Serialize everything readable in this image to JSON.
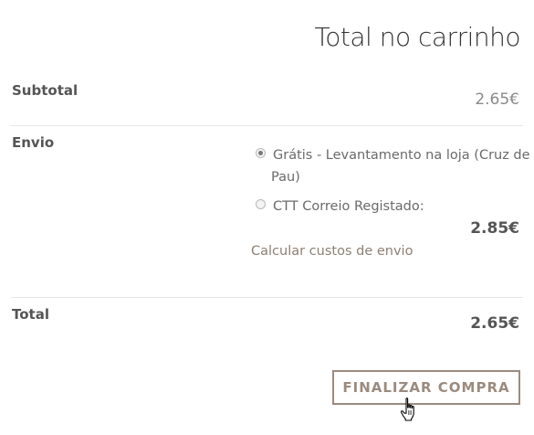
{
  "cart_totals": {
    "title": "Total no carrinho",
    "subtotal": {
      "label": "Subtotal",
      "amount": "2.65€"
    },
    "shipping": {
      "label": "Envio",
      "options": [
        {
          "label": "Grátis - Levantamento na loja (Cruz de Pau)",
          "selected": true
        },
        {
          "label": "CTT Correio Registado:",
          "selected": false
        }
      ],
      "ctt_price": "2.85€",
      "calculate_link": "Calcular custos de envio"
    },
    "total": {
      "label": "Total",
      "amount": "2.65€"
    },
    "checkout_button": "FINALIZAR COMPRA"
  },
  "colors": {
    "accent": "#9b8b7e",
    "link": "#8e7f73",
    "text": "#555555"
  },
  "icons": {
    "cursor": "hand-pointer-icon"
  }
}
